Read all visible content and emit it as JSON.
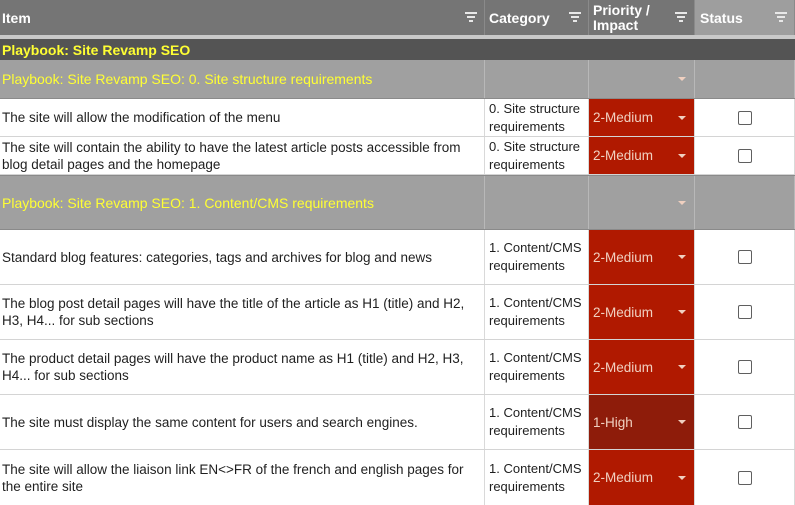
{
  "header": {
    "item": "Item",
    "category": "Category",
    "priority": "Priority /\nImpact",
    "status": "Status"
  },
  "groups": [
    {
      "label": "Playbook: Site Revamp SEO"
    },
    {
      "label": "Playbook: Site Revamp SEO: 0. Site structure requirements"
    },
    {
      "label": "Playbook: Site Revamp SEO: 1. Content/CMS requirements"
    }
  ],
  "rows": [
    {
      "item": "The site will allow the modification of the menu",
      "category": "0. Site structure requirements",
      "priority": "2-Medium",
      "checked": false
    },
    {
      "item": "The site will contain the ability to have the latest article posts accessible from blog detail pages and the homepage",
      "category": "0. Site structure requirements",
      "priority": "2-Medium",
      "checked": false
    },
    {
      "item": "Standard blog features: categories, tags and archives for blog and news",
      "category": "1. Content/CMS requirements",
      "priority": "2-Medium",
      "checked": false
    },
    {
      "item": "The blog post detail pages will have the title of the article as H1 (title) and H2, H3, H4... for sub sections",
      "category": "1. Content/CMS requirements",
      "priority": "2-Medium",
      "checked": false
    },
    {
      "item": "The product detail pages will have the product name as H1 (title) and H2, H3, H4... for sub sections",
      "category": "1. Content/CMS requirements",
      "priority": "2-Medium",
      "checked": false
    },
    {
      "item": "The site must display the same content for users and search engines.",
      "category": "1. Content/CMS requirements",
      "priority": "1-High",
      "checked": false
    },
    {
      "item": "The site will allow the liaison link EN<>FR of the french and english pages for the entire site",
      "category": "1. Content/CMS requirements",
      "priority": "2-Medium",
      "checked": false
    }
  ]
}
